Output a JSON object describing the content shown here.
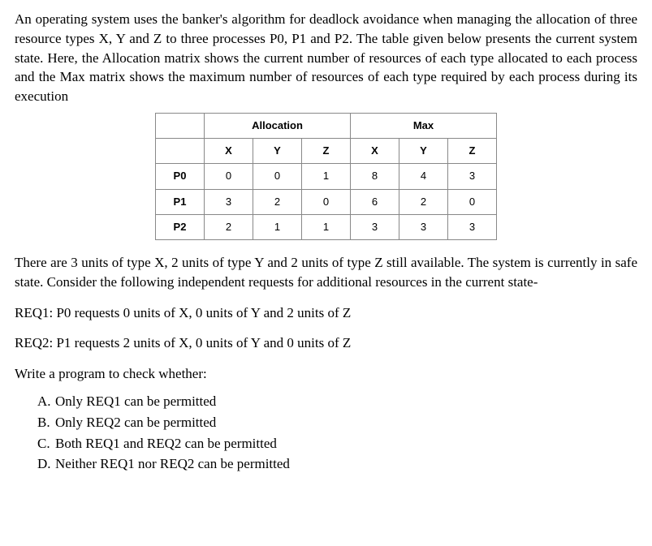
{
  "intro": "An operating system uses the banker's algorithm for deadlock avoidance when managing the allocation of three resource types X, Y and Z to three processes P0, P1 and P2. The table given below presents the current system state. Here, the Allocation matrix shows the current number of resources of each type allocated to each process and the Max matrix shows the maximum number of resources of each type required by each process during its execution",
  "headers": {
    "allocation": "Allocation",
    "max": "Max",
    "x": "X",
    "y": "Y",
    "z": "Z"
  },
  "rows": [
    {
      "label": "P0",
      "alloc": [
        "0",
        "0",
        "1"
      ],
      "max": [
        "8",
        "4",
        "3"
      ]
    },
    {
      "label": "P1",
      "alloc": [
        "3",
        "2",
        "0"
      ],
      "max": [
        "6",
        "2",
        "0"
      ]
    },
    {
      "label": "P2",
      "alloc": [
        "2",
        "1",
        "1"
      ],
      "max": [
        "3",
        "3",
        "3"
      ]
    }
  ],
  "middle": "There are 3 units of type X, 2 units of type Y and 2 units of type Z still available. The system is currently in safe state. Consider the following independent requests for additional resources in the current state-",
  "req1": "REQ1: P0 requests 0 units of X, 0 units of Y and 2 units of Z",
  "req2": "REQ2: P1 requests 2 units of X, 0 units of Y and 0 units of Z",
  "prompt": "Write a program to check whether:",
  "options": [
    {
      "letter": "A.",
      "text": "Only REQ1 can be permitted"
    },
    {
      "letter": "B.",
      "text": "Only REQ2 can be permitted"
    },
    {
      "letter": "C.",
      "text": "Both REQ1 and REQ2 can be permitted"
    },
    {
      "letter": "D.",
      "text": "Neither REQ1 nor REQ2 can be permitted"
    }
  ],
  "chart_data": {
    "type": "table",
    "title": "Banker's Algorithm State",
    "processes": [
      "P0",
      "P1",
      "P2"
    ],
    "resources": [
      "X",
      "Y",
      "Z"
    ],
    "allocation": [
      [
        0,
        0,
        1
      ],
      [
        3,
        2,
        0
      ],
      [
        2,
        1,
        1
      ]
    ],
    "max": [
      [
        8,
        4,
        3
      ],
      [
        6,
        2,
        0
      ],
      [
        3,
        3,
        3
      ]
    ],
    "available": [
      3,
      2,
      2
    ]
  }
}
